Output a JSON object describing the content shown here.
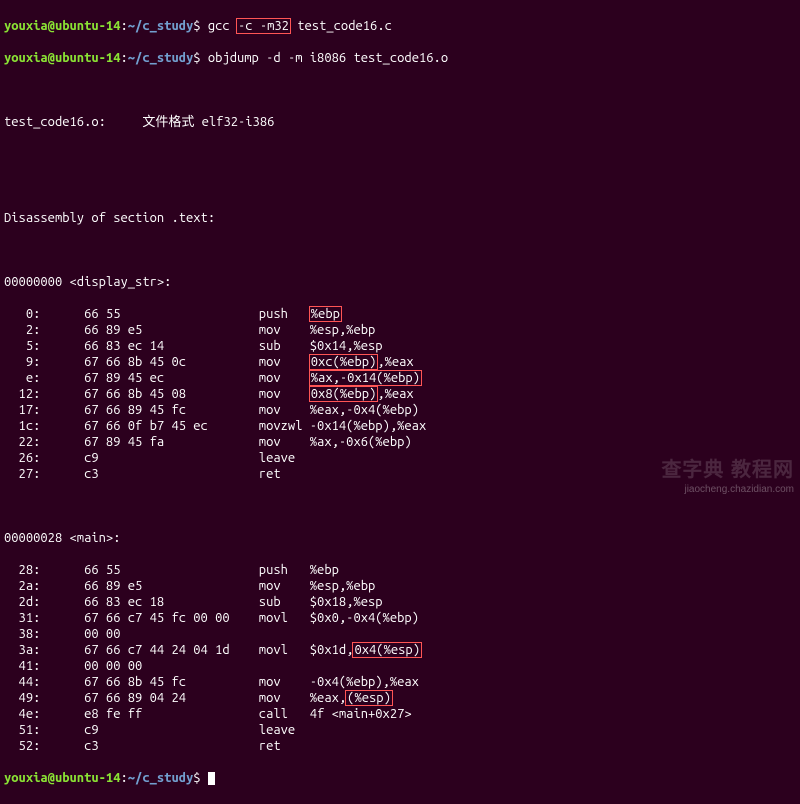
{
  "prompt": {
    "user": "youxia@ubuntu-14",
    "sep": ":",
    "path": "~/c_study",
    "dollar": "$"
  },
  "commands": [
    {
      "pre": "gcc ",
      "hl": "-c -m32",
      "post": " test_code16.c"
    },
    {
      "pre": "objdump -d -m i8086 test_code16.o",
      "hl": "",
      "post": ""
    }
  ],
  "header": {
    "file_line": "test_code16.o:     文件格式 elf32-i386",
    "section_line": "Disassembly of section .text:"
  },
  "sym_display": "00000000 <display_str>:",
  "sym_main": "00000028 <main>:",
  "disasm_display": [
    {
      "a": "   0:",
      "b": "66 55               ",
      "m": "push",
      "op": "",
      "hl": "%ebp"
    },
    {
      "a": "   2:",
      "b": "66 89 e5            ",
      "m": "mov ",
      "op": "   %esp,%ebp",
      "hl": ""
    },
    {
      "a": "   5:",
      "b": "66 83 ec 14         ",
      "m": "sub ",
      "op": "   $0x14,%esp",
      "hl": ""
    },
    {
      "a": "   9:",
      "b": "67 66 8b 45 0c      ",
      "m": "mov ",
      "op": "   ",
      "hl": "0xc(%ebp)",
      "tail": ",%eax"
    },
    {
      "a": "   e:",
      "b": "67 89 45 ec         ",
      "m": "mov ",
      "op": "   ",
      "hl": "%ax,-0x14(%ebp)",
      "tail": ""
    },
    {
      "a": "  12:",
      "b": "67 66 8b 45 08      ",
      "m": "mov ",
      "op": "   ",
      "hl": "0x8(%ebp)",
      "tail": ",%eax"
    },
    {
      "a": "  17:",
      "b": "67 66 89 45 fc      ",
      "m": "mov ",
      "op": "   %eax,-0x4(%ebp)",
      "hl": ""
    },
    {
      "a": "  1c:",
      "b": "67 66 0f b7 45 ec   ",
      "m": "movzwl",
      "op": " -0x14(%ebp),%eax",
      "hl": ""
    },
    {
      "a": "  22:",
      "b": "67 89 45 fa         ",
      "m": "mov ",
      "op": "   %ax,-0x6(%ebp)",
      "hl": ""
    },
    {
      "a": "  26:",
      "b": "c9                  ",
      "m": "leave",
      "op": "",
      "hl": ""
    },
    {
      "a": "  27:",
      "b": "c3                  ",
      "m": "ret ",
      "op": "",
      "hl": ""
    }
  ],
  "disasm_main": [
    {
      "a": "  28:",
      "b": "66 55               ",
      "m": "push",
      "op": "   %ebp",
      "hl": ""
    },
    {
      "a": "  2a:",
      "b": "66 89 e5            ",
      "m": "mov ",
      "op": "   %esp,%ebp",
      "hl": ""
    },
    {
      "a": "  2d:",
      "b": "66 83 ec 18         ",
      "m": "sub ",
      "op": "   $0x18,%esp",
      "hl": ""
    },
    {
      "a": "  31:",
      "b": "67 66 c7 45 fc 00 00",
      "m": "movl",
      "op": "   $0x0,-0x4(%ebp)",
      "hl": ""
    },
    {
      "a": "  38:",
      "b": "00 00               ",
      "m": "    ",
      "op": "",
      "hl": ""
    },
    {
      "a": "  3a:",
      "b": "67 66 c7 44 24 04 1d",
      "m": "movl",
      "op": "   $0x1d,",
      "hl": "0x4(%esp)",
      "tail": ""
    },
    {
      "a": "  41:",
      "b": "00 00 00            ",
      "m": "    ",
      "op": "",
      "hl": ""
    },
    {
      "a": "  44:",
      "b": "67 66 8b 45 fc      ",
      "m": "mov ",
      "op": "   -0x4(%ebp),%eax",
      "hl": ""
    },
    {
      "a": "  49:",
      "b": "67 66 89 04 24      ",
      "m": "mov ",
      "op": "   %eax,",
      "hl": "(%esp)",
      "tail": ""
    },
    {
      "a": "  4e:",
      "b": "e8 fe ff            ",
      "m": "call",
      "op": "   4f <main+0x27>",
      "hl": ""
    },
    {
      "a": "  51:",
      "b": "c9                  ",
      "m": "leave",
      "op": "",
      "hl": ""
    },
    {
      "a": "  52:",
      "b": "c3                  ",
      "m": "ret ",
      "op": "",
      "hl": ""
    }
  ],
  "watermark": "查字典 教程网",
  "watermark2": "jiaocheng.chazidian.com"
}
